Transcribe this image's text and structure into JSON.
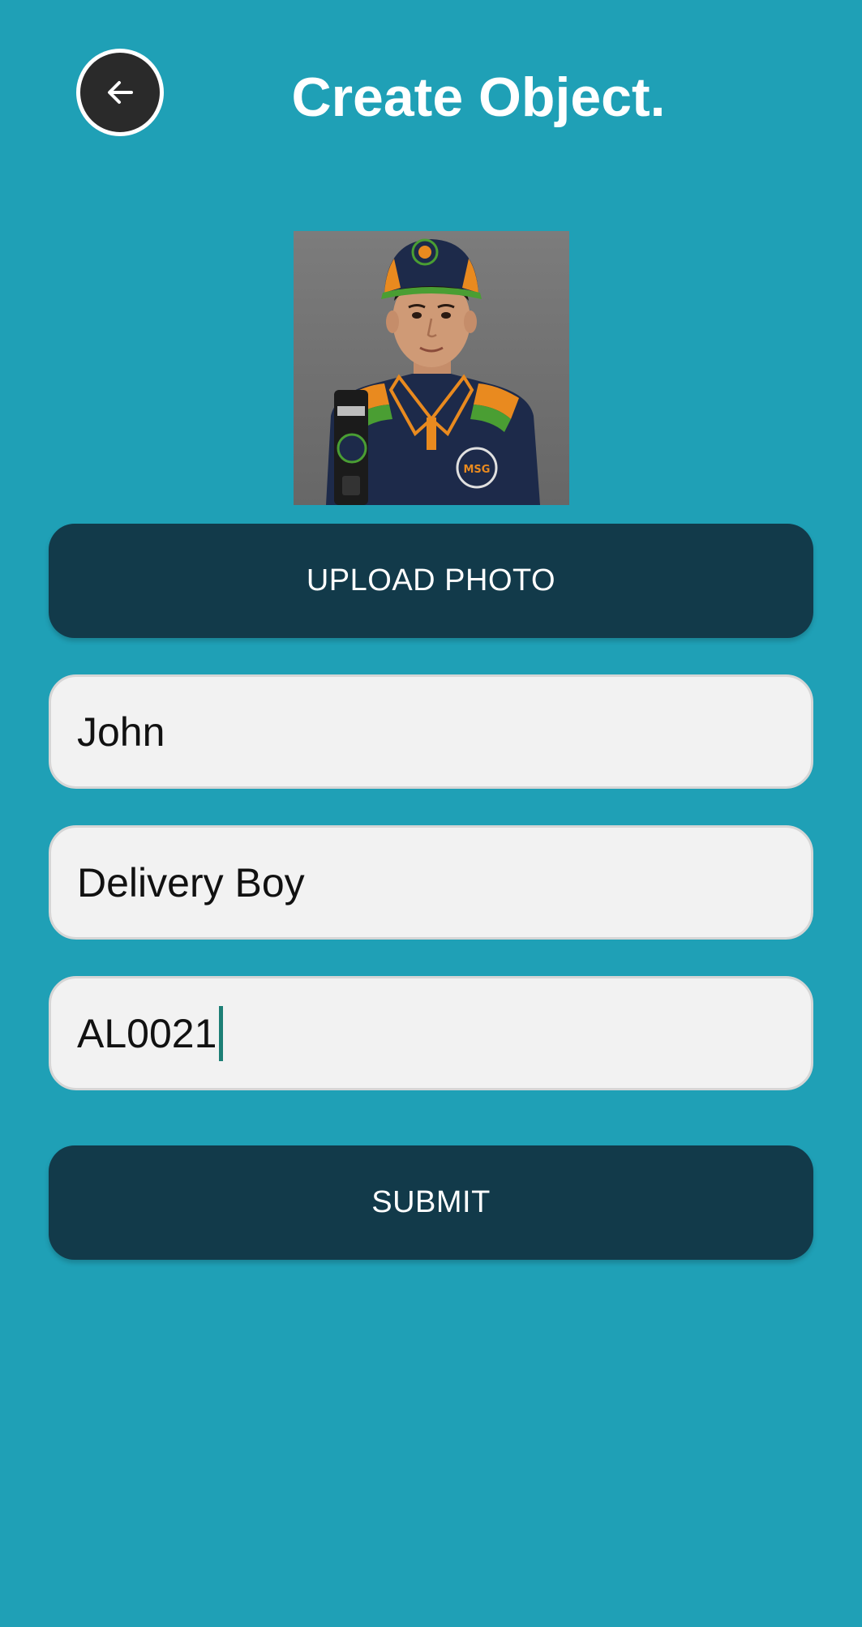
{
  "header": {
    "title": "Create Object."
  },
  "form": {
    "upload_label": "UPLOAD PHOTO",
    "name_value": "John",
    "role_value": "Delivery Boy",
    "code_value": "AL0021",
    "submit_label": "SUBMIT"
  },
  "photo": {
    "logo_text": "MSG"
  },
  "icons": {
    "back": "arrow-left-icon"
  },
  "colors": {
    "background": "#1fa0b6",
    "button": "#123a4a",
    "field": "#f2f2f2",
    "caret": "#1d7f76"
  }
}
